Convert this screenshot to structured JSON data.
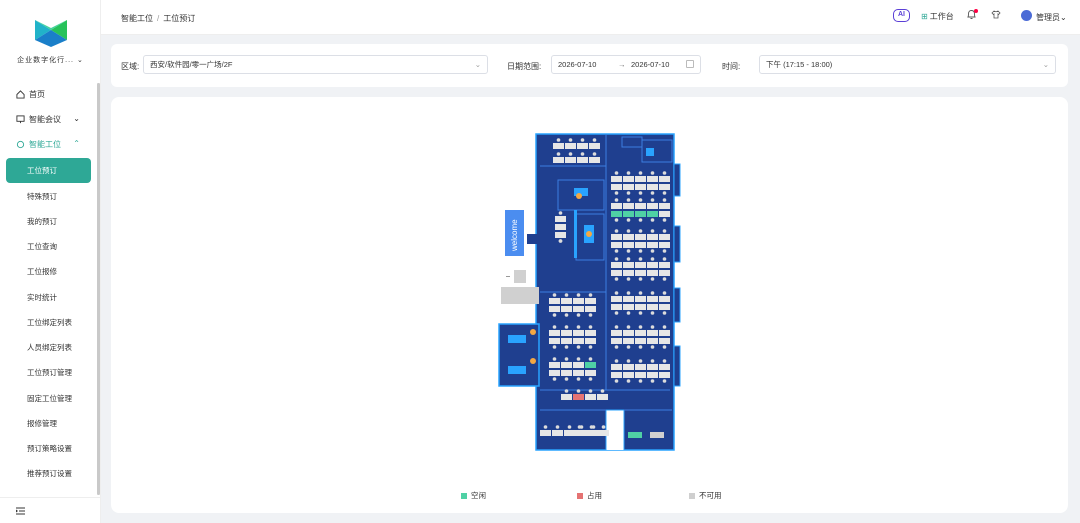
{
  "sidebar": {
    "org_name": "企业数字化行...",
    "menu": [
      {
        "label": "首页"
      },
      {
        "label": "智能会议"
      },
      {
        "label": "智能工位"
      }
    ],
    "sub_items": [
      {
        "label": "工位预订",
        "active": true
      },
      {
        "label": "特殊预订"
      },
      {
        "label": "我的预订"
      },
      {
        "label": "工位查询"
      },
      {
        "label": "工位报修"
      },
      {
        "label": "实时统计"
      },
      {
        "label": "工位绑定列表"
      },
      {
        "label": "人员绑定列表"
      },
      {
        "label": "工位预订管理"
      },
      {
        "label": "固定工位管理"
      },
      {
        "label": "报修管理"
      },
      {
        "label": "预订策略设置"
      },
      {
        "label": "推荐预订设置"
      }
    ],
    "collapse_icon": "menu-fold-icon"
  },
  "header": {
    "breadcrumb": [
      "智能工位",
      "工位预订"
    ],
    "ai_label": "AI",
    "workbench": "工作台",
    "user": "管理员"
  },
  "filter": {
    "region_label": "区域:",
    "region_value": "西安/软件园/零一广场/2F",
    "date_label": "日期范围:",
    "date_start": "2026-07-10",
    "date_arrow": "→",
    "date_end": "2026-07-10",
    "time_label": "时间:",
    "time_value": "下午 (17:15 - 18:00)"
  },
  "map": {
    "welcome": "welcome"
  },
  "legend": [
    {
      "label": "空闲",
      "color": "#4fd1a5"
    },
    {
      "label": "占用",
      "color": "#e57373"
    },
    {
      "label": "不可用",
      "color": "#cfcfcf"
    }
  ],
  "colors": {
    "accent": "#2ea896",
    "floor": "#1f3f8f",
    "floor_border": "#29a3ff"
  }
}
